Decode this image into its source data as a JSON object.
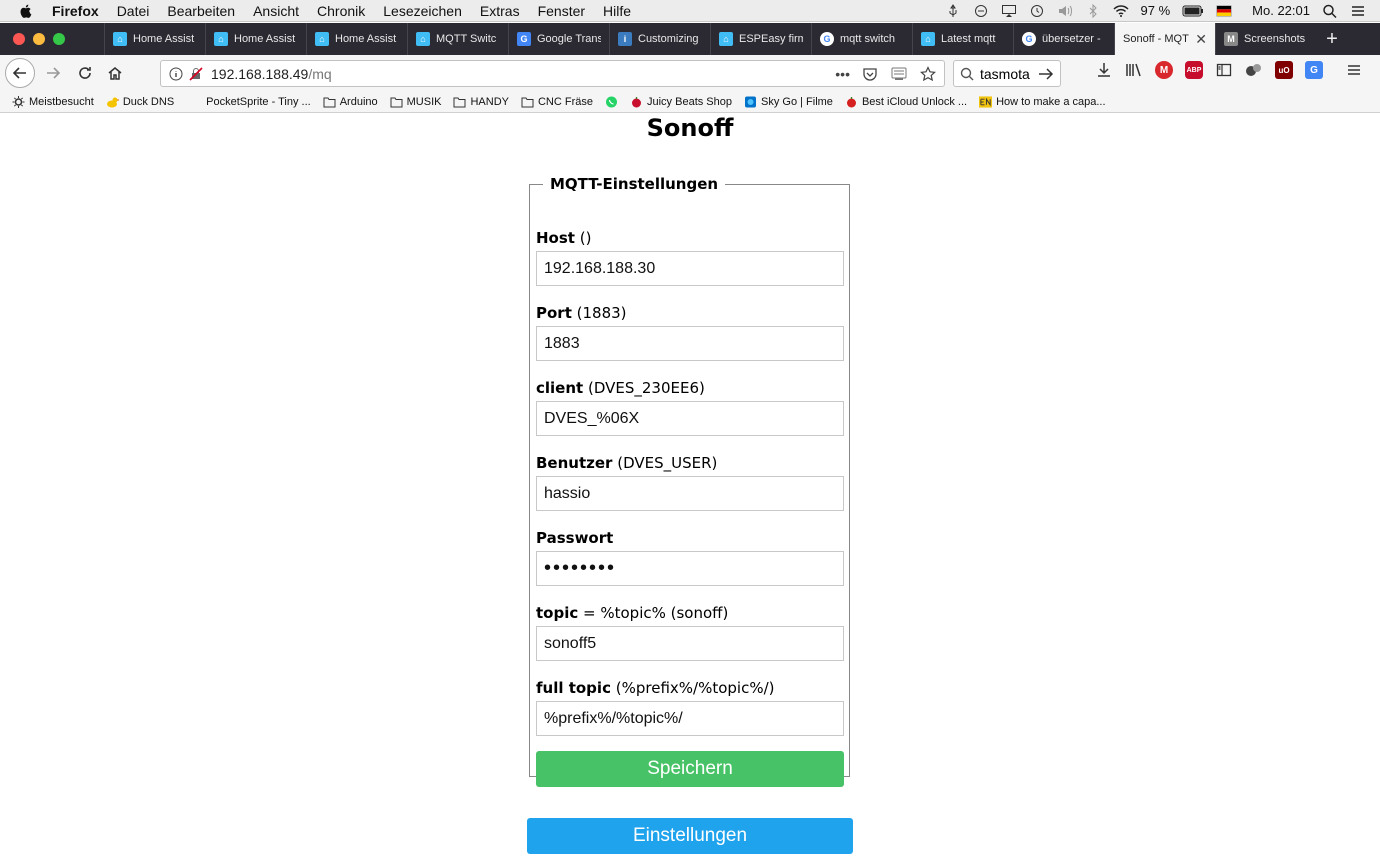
{
  "menubar": {
    "app": "Firefox",
    "items": [
      "Datei",
      "Bearbeiten",
      "Ansicht",
      "Chronik",
      "Lesezeichen",
      "Extras",
      "Fenster",
      "Hilfe"
    ],
    "battery": "97 %",
    "clock": "Mo. 22:01"
  },
  "tabs": [
    {
      "title": "Home Assist",
      "favicon_color": "#41bdf5"
    },
    {
      "title": "Home Assist",
      "favicon_color": "#41bdf5"
    },
    {
      "title": "Home Assist",
      "favicon_color": "#41bdf5"
    },
    {
      "title": "MQTT Switc",
      "favicon_color": "#41bdf5"
    },
    {
      "title": "Google Trans",
      "favicon_color": "#4285f4"
    },
    {
      "title": "Customizing",
      "favicon_color": "#3b7bbf"
    },
    {
      "title": "ESPEasy firm",
      "favicon_color": "#41bdf5"
    },
    {
      "title": "mqtt switch",
      "favicon_color": "#ffffff"
    },
    {
      "title": "Latest mqtt",
      "favicon_color": "#41bdf5"
    },
    {
      "title": "übersetzer -",
      "favicon_color": "#ffffff"
    },
    {
      "title": "Sonoff - MQT",
      "favicon_color": "",
      "active": true
    },
    {
      "title": "Screenshots",
      "favicon_color": "#888888"
    }
  ],
  "navbar": {
    "url_host": "192.168.188.49",
    "url_path": "/mq",
    "search_value": "tasmota"
  },
  "bookmarks": [
    "Meistbesucht",
    "Duck DNS",
    "PocketSprite - Tiny ...",
    "Arduino",
    "MUSIK",
    "HANDY",
    "CNC Fräse",
    "",
    "Juicy Beats Shop",
    "Sky Go | Filme",
    "Best iCloud Unlock ...",
    "How to make a capa..."
  ],
  "page": {
    "title": "Sonoff",
    "legend": "MQTT-Einstellungen",
    "fields": {
      "host": {
        "label": "Host",
        "hint": "()",
        "value": "192.168.188.30"
      },
      "port": {
        "label": "Port",
        "hint": "(1883)",
        "value": "1883"
      },
      "client": {
        "label": "client",
        "hint": "(DVES_230EE6)",
        "value": "DVES_%06X"
      },
      "user": {
        "label": "Benutzer",
        "hint": "(DVES_USER)",
        "value": "hassio"
      },
      "password": {
        "label": "Passwort",
        "hint": "",
        "value": "••••••••"
      },
      "topic": {
        "label": "topic",
        "hint": "= %topic% (sonoff)",
        "value": "sonoff5"
      },
      "full_topic": {
        "label": "full topic",
        "hint": "(%prefix%/%topic%/)",
        "value": "%prefix%/%topic%/"
      }
    },
    "save_label": "Speichern",
    "settings_label": "Einstellungen"
  },
  "colors": {
    "save_button": "#47c266",
    "settings_button": "#1fa3ec"
  }
}
